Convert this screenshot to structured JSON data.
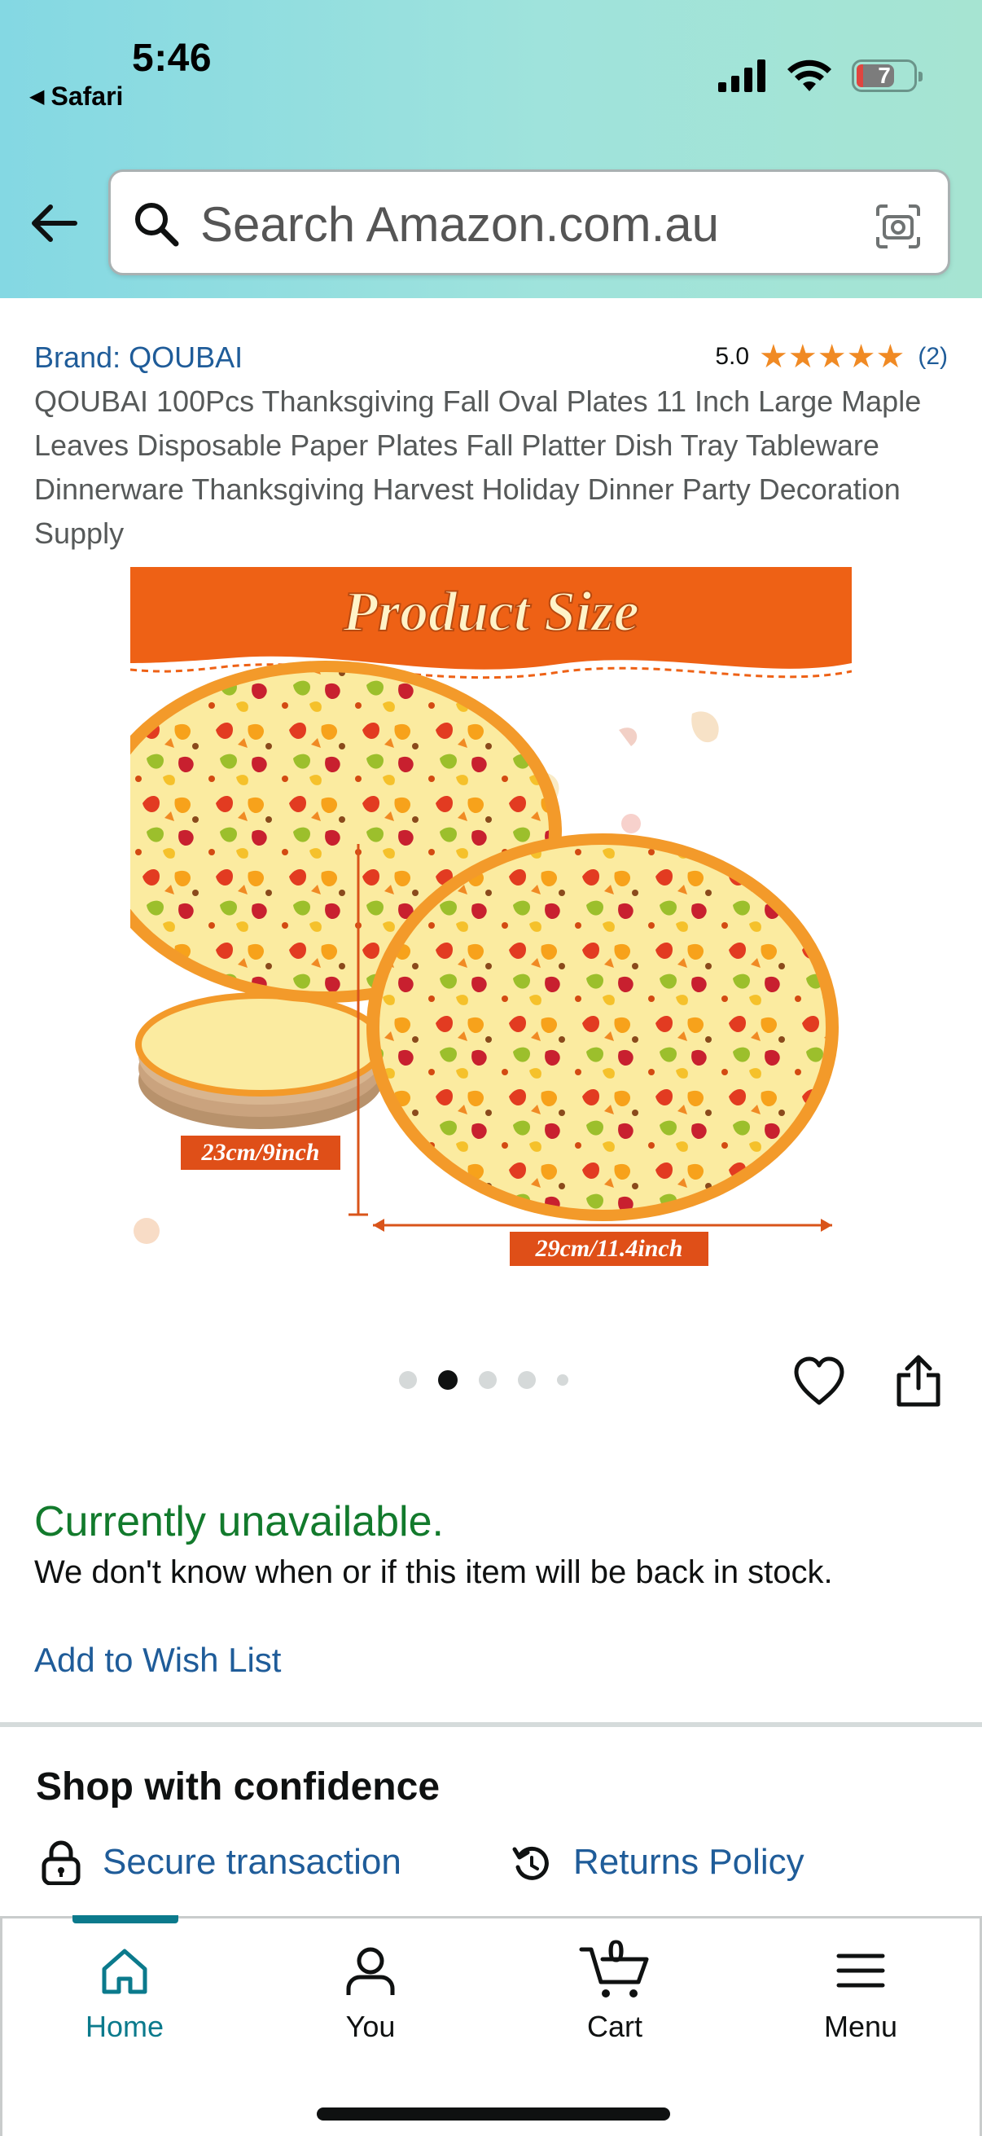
{
  "status_bar": {
    "time": "5:46",
    "back_app": "Safari",
    "battery": "7"
  },
  "search": {
    "placeholder": "Search Amazon.com.au"
  },
  "product": {
    "brand": "Brand: QOUBAI",
    "rating_score": "5.0",
    "stars": "★★★★★",
    "rating_count": "(2)",
    "title": "QOUBAI 100Pcs Thanksgiving Fall Oval Plates 11 Inch Large Maple Leaves Disposable Paper Plates Fall Platter Dish Tray Tableware Dinnerware Thanksgiving Harvest Holiday Dinner Party Decoration Supply"
  },
  "image": {
    "banner": "Product Size",
    "width_label": "23cm/9inch",
    "length_label": "29cm/11.4inch",
    "colors": {
      "banner": "#ee6115",
      "plate_rim": "#f39a2a",
      "plate_fill": "#fbeba0",
      "label_bg": "#df4f18"
    }
  },
  "carousel": {
    "count": 5,
    "active_index": 1
  },
  "availability": {
    "status": "Currently unavailable.",
    "message": "We don't know when or if this item will be back in stock.",
    "wishlist_link": "Add to Wish List"
  },
  "confidence": {
    "title": "Shop with confidence",
    "secure": "Secure transaction",
    "returns": "Returns Policy"
  },
  "nav": {
    "home": "Home",
    "you": "You",
    "cart": "Cart",
    "cart_count": "0",
    "menu": "Menu"
  },
  "theme": {
    "link": "#1f5c99",
    "available_green": "#127a2c",
    "nav_active": "#0b7a8c",
    "star": "#f08a24"
  }
}
